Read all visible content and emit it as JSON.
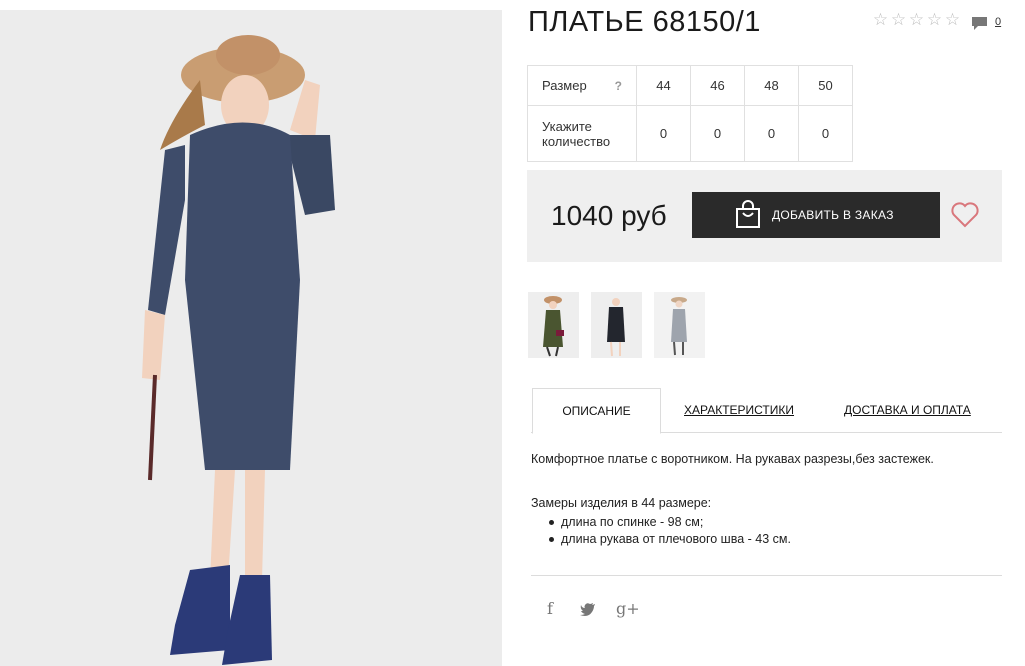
{
  "product": {
    "title": "ПЛАТЬЕ 68150/1",
    "rating_stars": 5,
    "rating_icon": "star-outline-icon",
    "comments_count": "0",
    "comment_icon": "speech-bubble-icon"
  },
  "size_table": {
    "size_label": "Размер",
    "help_label": "?",
    "qty_label": "Укажите количество",
    "sizes": [
      "44",
      "46",
      "48",
      "50"
    ],
    "quantities": [
      "0",
      "0",
      "0",
      "0"
    ]
  },
  "purchase": {
    "price": "1040 руб",
    "add_button_label": "ДОБАВИТЬ В ЗАКАЗ",
    "bag_icon": "shopping-bag-icon",
    "wishlist_icon": "heart-icon",
    "accent_color": "#d9777c",
    "button_color": "#2a2a2a"
  },
  "tabs": [
    {
      "label": "ОПИСАНИЕ",
      "active": true
    },
    {
      "label": "ХАРАКТЕРИСТИКИ",
      "active": false
    },
    {
      "label": "ДОСТАВКА И ОПЛАТА",
      "active": false
    }
  ],
  "description": {
    "text": "Комфортное платье с воротником. На рукавах разрезы,без застежек.",
    "measures_title": "Замеры изделия в 44 размере:",
    "measures": [
      "длина по спинке - 98 см;",
      "длина рукава от плечового шва - 43 см."
    ]
  },
  "social": {
    "facebook": "f",
    "twitter_icon": "twitter-icon",
    "googleplus": "g+"
  }
}
